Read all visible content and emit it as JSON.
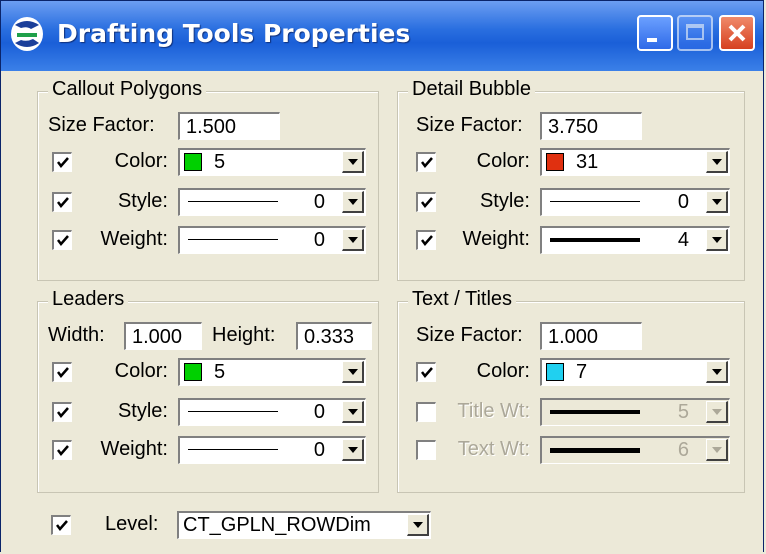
{
  "window": {
    "title": "Drafting Tools Properties"
  },
  "callout": {
    "title": "Callout Polygons",
    "size_label": "Size Factor:",
    "size_value": "1.500",
    "color_label": "Color:",
    "color_value": "5",
    "color_hex": "#00d000",
    "style_label": "Style:",
    "style_value": "0",
    "weight_label": "Weight:",
    "weight_value": "0"
  },
  "detail": {
    "title": "Detail Bubble",
    "size_label": "Size Factor:",
    "size_value": "3.750",
    "color_label": "Color:",
    "color_value": "31",
    "color_hex": "#e03010",
    "style_label": "Style:",
    "style_value": "0",
    "weight_label": "Weight:",
    "weight_value": "4"
  },
  "leaders": {
    "title": "Leaders",
    "width_label": "Width:",
    "width_value": "1.000",
    "height_label": "Height:",
    "height_value": "0.333",
    "color_label": "Color:",
    "color_value": "5",
    "color_hex": "#00d000",
    "style_label": "Style:",
    "style_value": "0",
    "weight_label": "Weight:",
    "weight_value": "0"
  },
  "text_titles": {
    "title": "Text / Titles",
    "size_label": "Size Factor:",
    "size_value": "1.000",
    "color_label": "Color:",
    "color_value": "7",
    "color_hex": "#20d0f0",
    "title_wt_label": "Title Wt:",
    "title_wt_value": "5",
    "text_wt_label": "Text Wt:",
    "text_wt_value": "6"
  },
  "level": {
    "label": "Level:",
    "value": "CT_GPLN_ROWDim"
  }
}
